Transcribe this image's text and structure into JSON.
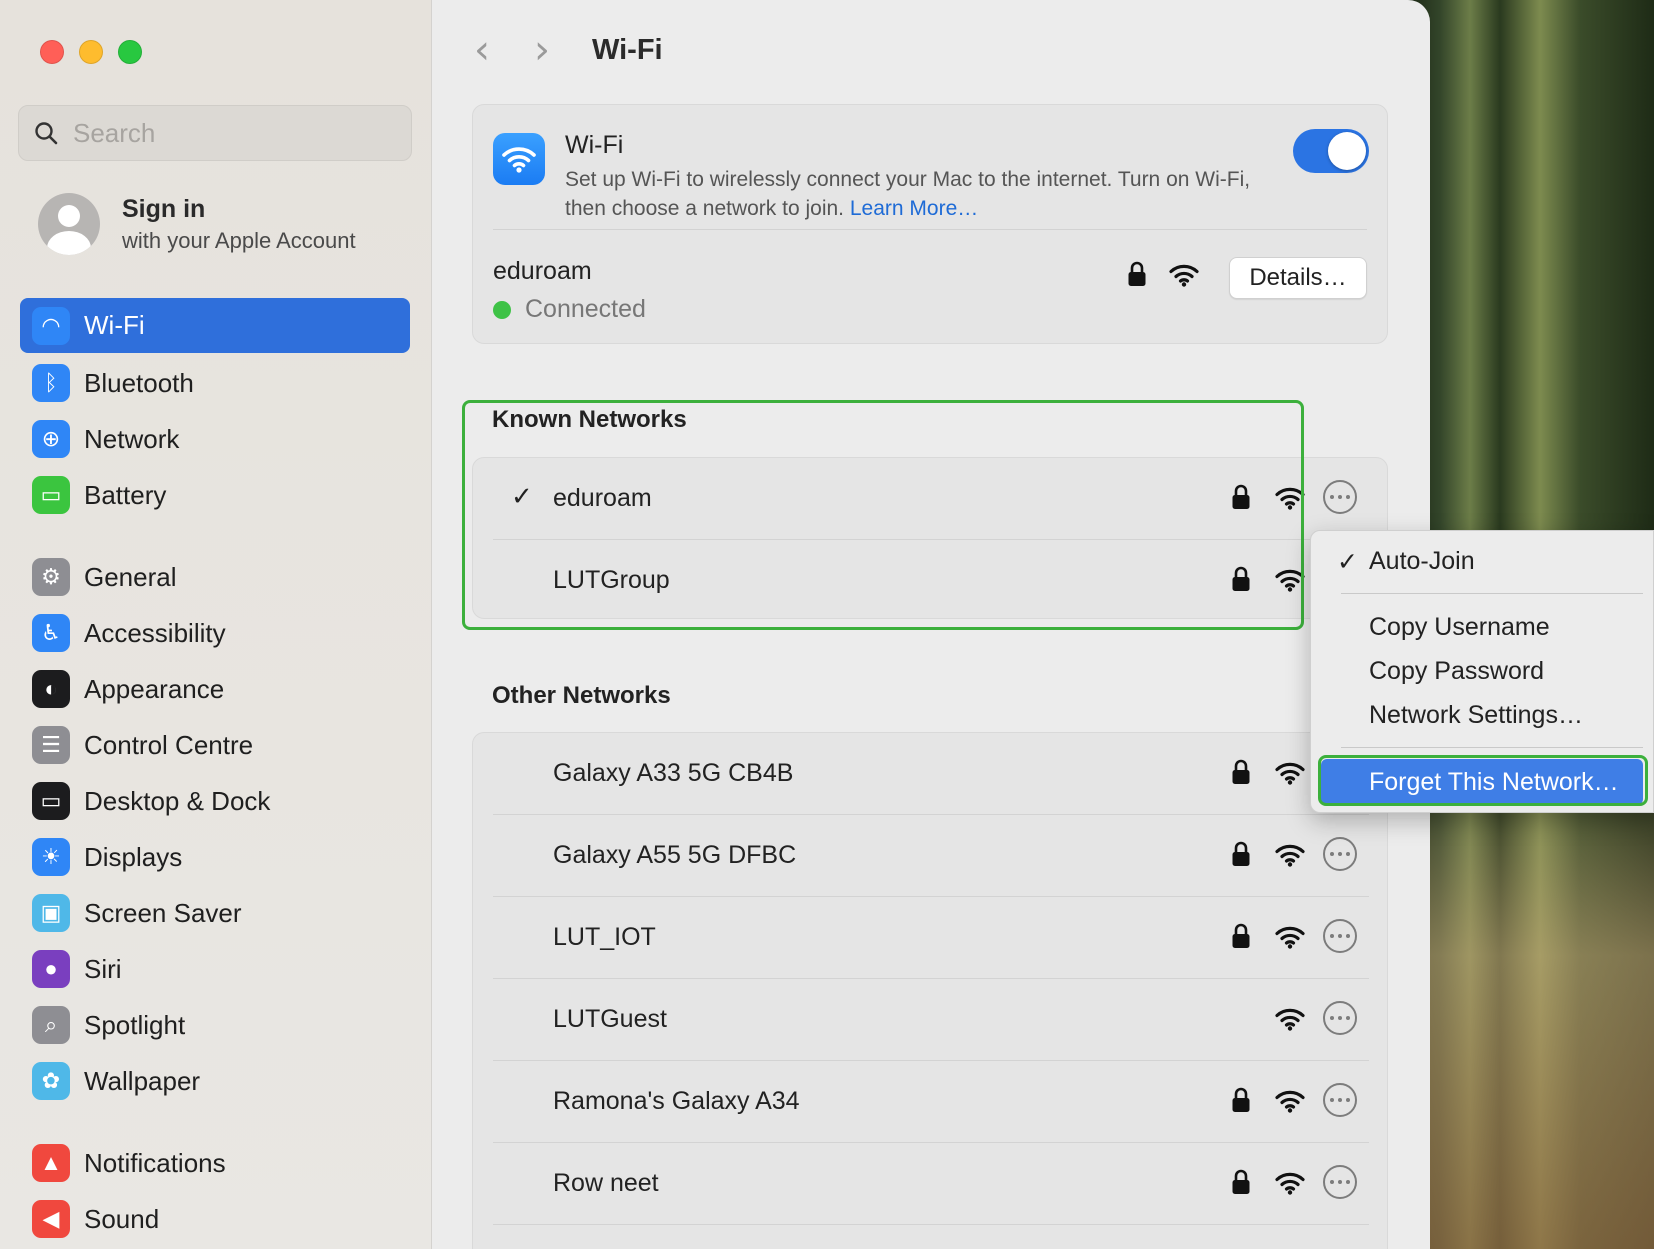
{
  "window": {
    "title": "Wi-Fi"
  },
  "colors": {
    "accent": "#2f6fdb",
    "highlight": "#3cb03c",
    "connected": "#3ec246"
  },
  "sidebar": {
    "search_placeholder": "Search",
    "account": {
      "title": "Sign in",
      "subtitle": "with your Apple Account"
    },
    "items": [
      {
        "label": "Wi-Fi",
        "icon": "wifi-icon",
        "color": "#2f86f6"
      },
      {
        "label": "Bluetooth",
        "icon": "bluetooth-icon",
        "color": "#2f86f6"
      },
      {
        "label": "Network",
        "icon": "globe-icon",
        "color": "#2f86f6"
      },
      {
        "label": "Battery",
        "icon": "battery-icon",
        "color": "#3bc53f"
      },
      {
        "label": "General",
        "icon": "gear-icon",
        "color": "#8e8e93"
      },
      {
        "label": "Accessibility",
        "icon": "accessibility-icon",
        "color": "#2f86f6"
      },
      {
        "label": "Appearance",
        "icon": "appearance-icon",
        "color": "#1c1c1e"
      },
      {
        "label": "Control Centre",
        "icon": "control-centre-icon",
        "color": "#8e8e93"
      },
      {
        "label": "Desktop & Dock",
        "icon": "dock-icon",
        "color": "#1c1c1e"
      },
      {
        "label": "Displays",
        "icon": "sun-icon",
        "color": "#2f86f6"
      },
      {
        "label": "Screen Saver",
        "icon": "screen-saver-icon",
        "color": "#4fb8e8"
      },
      {
        "label": "Siri",
        "icon": "siri-icon",
        "color": "#7a3fbf"
      },
      {
        "label": "Spotlight",
        "icon": "spotlight-icon",
        "color": "#8e8e93"
      },
      {
        "label": "Wallpaper",
        "icon": "wallpaper-icon",
        "color": "#4fb8e8"
      },
      {
        "label": "Notifications",
        "icon": "bell-icon",
        "color": "#f0483e"
      },
      {
        "label": "Sound",
        "icon": "speaker-icon",
        "color": "#f0483e"
      }
    ]
  },
  "wifi": {
    "title": "Wi-Fi",
    "description": "Set up Wi-Fi to wirelessly connect your Mac to the internet. Turn on Wi-Fi, then choose a network to join.",
    "learn_more": "Learn More…",
    "enabled": true,
    "current_network": "eduroam",
    "status": "Connected",
    "details_label": "Details…"
  },
  "known": {
    "title": "Known Networks",
    "networks": [
      {
        "name": "eduroam",
        "check": "✓",
        "locked": true
      },
      {
        "name": "LUTGroup",
        "check": "",
        "locked": true
      }
    ]
  },
  "other": {
    "title": "Other Networks",
    "networks": [
      {
        "name": "Galaxy A33 5G CB4B",
        "locked": true
      },
      {
        "name": "Galaxy A55 5G DFBC",
        "locked": true
      },
      {
        "name": "LUT_IOT",
        "locked": true
      },
      {
        "name": "LUTGuest",
        "locked": false
      },
      {
        "name": "Ramona's Galaxy A34",
        "locked": true
      },
      {
        "name": "Row neet",
        "locked": true
      }
    ]
  },
  "context_menu": {
    "auto_join": {
      "check": "✓",
      "label": "Auto-Join"
    },
    "copy_username": "Copy Username",
    "copy_password": "Copy Password",
    "network_settings": "Network Settings…",
    "forget": "Forget This Network…"
  }
}
